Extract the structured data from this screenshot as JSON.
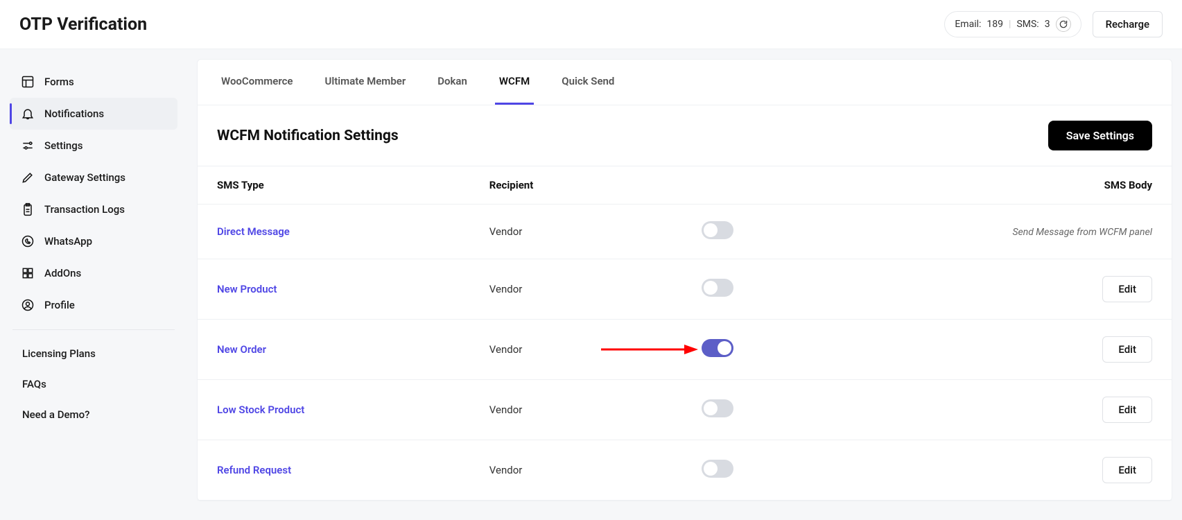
{
  "header": {
    "title": "OTP Verification",
    "email_label": "Email:",
    "email_value": "189",
    "sms_label": "SMS:",
    "sms_value": "3",
    "recharge": "Recharge"
  },
  "sidebar": {
    "items": [
      {
        "label": "Forms"
      },
      {
        "label": "Notifications"
      },
      {
        "label": "Settings"
      },
      {
        "label": "Gateway Settings"
      },
      {
        "label": "Transaction Logs"
      },
      {
        "label": "WhatsApp"
      },
      {
        "label": "AddOns"
      },
      {
        "label": "Profile"
      }
    ],
    "links": [
      {
        "label": "Licensing Plans"
      },
      {
        "label": "FAQs"
      },
      {
        "label": "Need a Demo?"
      }
    ]
  },
  "tabs": [
    {
      "label": "WooCommerce"
    },
    {
      "label": "Ultimate Member"
    },
    {
      "label": "Dokan"
    },
    {
      "label": "WCFM"
    },
    {
      "label": "Quick Send"
    }
  ],
  "panel": {
    "title": "WCFM Notification Settings",
    "save": "Save Settings",
    "columns": {
      "type": "SMS Type",
      "recipient": "Recipient",
      "body": "SMS Body"
    },
    "rows": [
      {
        "type": "Direct Message",
        "recipient": "Vendor",
        "enabled": false,
        "body_note": "Send Message from WCFM panel",
        "edit": false
      },
      {
        "type": "New Product",
        "recipient": "Vendor",
        "enabled": false,
        "edit": true
      },
      {
        "type": "New Order",
        "recipient": "Vendor",
        "enabled": true,
        "edit": true,
        "highlight": true
      },
      {
        "type": "Low Stock Product",
        "recipient": "Vendor",
        "enabled": false,
        "edit": true
      },
      {
        "type": "Refund Request",
        "recipient": "Vendor",
        "enabled": false,
        "edit": true
      }
    ],
    "edit_label": "Edit"
  }
}
